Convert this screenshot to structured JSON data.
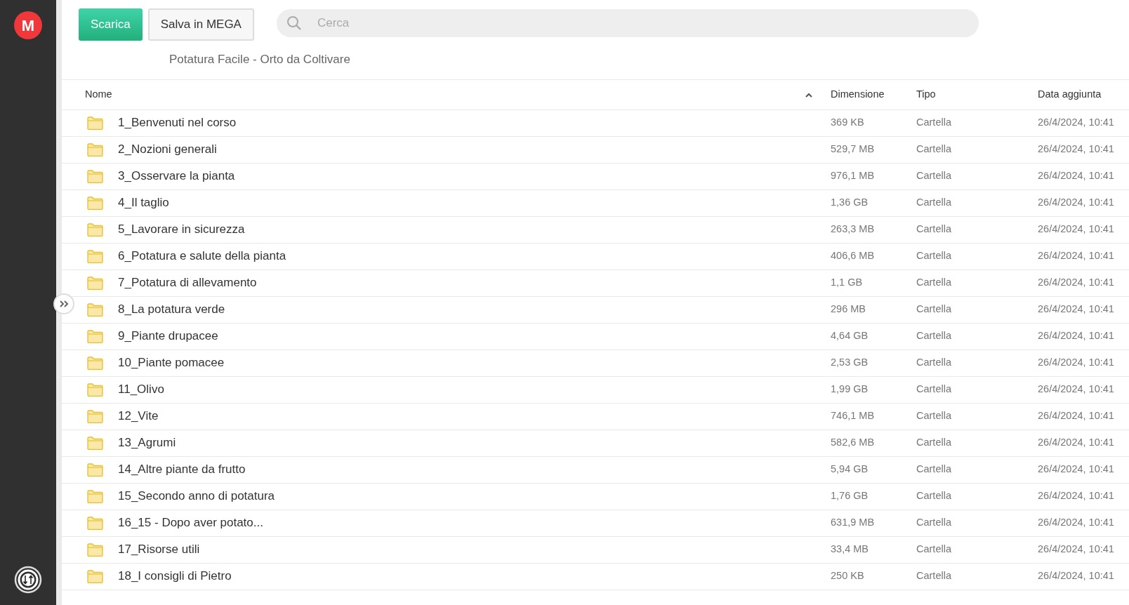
{
  "sidebar": {
    "logo": "M"
  },
  "toolbar": {
    "buttons": [
      {
        "label": "Scarica",
        "kind": "primary"
      },
      {
        "label": "Salva in MEGA",
        "kind": "secondary"
      }
    ],
    "search": {
      "placeholder": "Cerca"
    }
  },
  "breadcrumb": "Potatura Facile - Orto da Coltivare",
  "table": {
    "columns": [
      {
        "label": "Nome",
        "sorted": true
      },
      {
        "label": "Dimensione",
        "sorted": false
      },
      {
        "label": "Tipo",
        "sorted": false
      },
      {
        "label": "Data aggiunta",
        "sorted": false
      }
    ],
    "rows": [
      {
        "name": "1_Benvenuti nel corso",
        "size": "369 KB",
        "type": "Cartella",
        "date": "26/4/2024, 10:41"
      },
      {
        "name": "2_Nozioni generali",
        "size": "529,7 MB",
        "type": "Cartella",
        "date": "26/4/2024, 10:41"
      },
      {
        "name": "3_Osservare la pianta",
        "size": "976,1 MB",
        "type": "Cartella",
        "date": "26/4/2024, 10:41"
      },
      {
        "name": "4_Il taglio",
        "size": "1,36 GB",
        "type": "Cartella",
        "date": "26/4/2024, 10:41"
      },
      {
        "name": "5_Lavorare in sicurezza",
        "size": "263,3 MB",
        "type": "Cartella",
        "date": "26/4/2024, 10:41"
      },
      {
        "name": "6_Potatura e salute della pianta",
        "size": "406,6 MB",
        "type": "Cartella",
        "date": "26/4/2024, 10:41"
      },
      {
        "name": "7_Potatura di allevamento",
        "size": "1,1 GB",
        "type": "Cartella",
        "date": "26/4/2024, 10:41"
      },
      {
        "name": "8_La potatura verde",
        "size": "296 MB",
        "type": "Cartella",
        "date": "26/4/2024, 10:41"
      },
      {
        "name": "9_Piante drupacee",
        "size": "4,64 GB",
        "type": "Cartella",
        "date": "26/4/2024, 10:41"
      },
      {
        "name": "10_Piante pomacee",
        "size": "2,53 GB",
        "type": "Cartella",
        "date": "26/4/2024, 10:41"
      },
      {
        "name": "11_Olivo",
        "size": "1,99 GB",
        "type": "Cartella",
        "date": "26/4/2024, 10:41"
      },
      {
        "name": "12_Vite",
        "size": "746,1 MB",
        "type": "Cartella",
        "date": "26/4/2024, 10:41"
      },
      {
        "name": "13_Agrumi",
        "size": "582,6 MB",
        "type": "Cartella",
        "date": "26/4/2024, 10:41"
      },
      {
        "name": "14_Altre piante da frutto",
        "size": "5,94 GB",
        "type": "Cartella",
        "date": "26/4/2024, 10:41"
      },
      {
        "name": "15_Secondo anno di potatura",
        "size": "1,76 GB",
        "type": "Cartella",
        "date": "26/4/2024, 10:41"
      },
      {
        "name": "16_15 - Dopo aver potato...",
        "size": "631,9 MB",
        "type": "Cartella",
        "date": "26/4/2024, 10:41"
      },
      {
        "name": "17_Risorse utili",
        "size": "33,4 MB",
        "type": "Cartella",
        "date": "26/4/2024, 10:41"
      },
      {
        "name": "18_I consigli di Pietro",
        "size": "250 KB",
        "type": "Cartella",
        "date": "26/4/2024, 10:41"
      }
    ]
  }
}
